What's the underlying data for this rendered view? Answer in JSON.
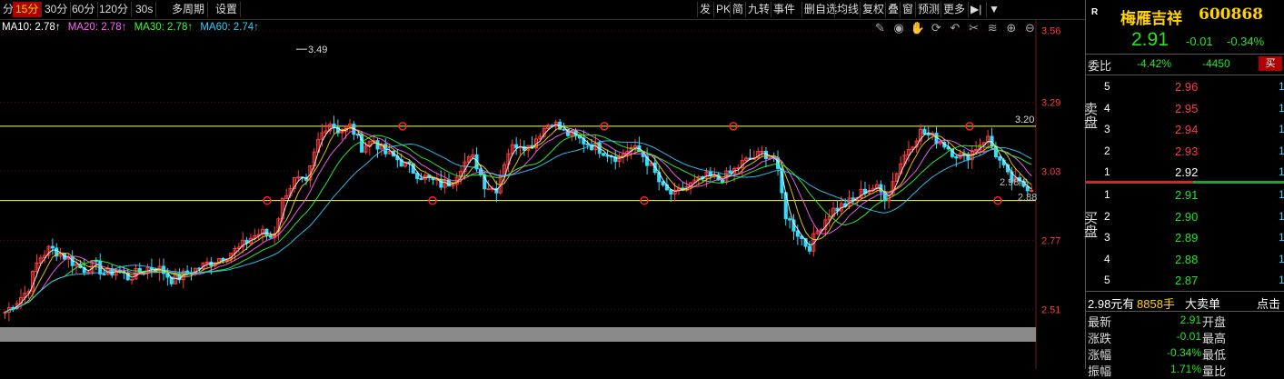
{
  "toolbar": {
    "periods": [
      "分",
      "15分",
      "30分",
      "60分",
      "120分",
      "30s",
      "多周期",
      "设置"
    ],
    "active_period": "15分",
    "tools": [
      "发",
      "PK",
      "简",
      "九转",
      "事件",
      "删自选",
      "均线",
      "复权",
      "叠",
      "窗",
      "预测",
      "更多",
      "▶|",
      "▼"
    ]
  },
  "ma": [
    {
      "label": "MA10: 2.78↑",
      "color": "#ffffff"
    },
    {
      "label": "MA20: 2.78↑",
      "color": "#ff66ff"
    },
    {
      "label": "MA30: 2.78↑",
      "color": "#33ff33"
    },
    {
      "label": "MA60: 2.74↑",
      "color": "#33ccff"
    }
  ],
  "chart_data": {
    "type": "candlestick",
    "y_ticks": [
      3.56,
      3.29,
      3.03,
      2.77,
      2.51
    ],
    "ylim": [
      2.45,
      3.6
    ],
    "resistance_line": 3.2,
    "support_line": 2.92,
    "resistance_label": "3.20",
    "high_label": "3.49",
    "annotations": [
      "2.98-2",
      "2.88"
    ],
    "close_series": [
      2.5,
      2.54,
      2.58,
      2.7,
      2.74,
      2.72,
      2.69,
      2.66,
      2.68,
      2.64,
      2.66,
      2.63,
      2.65,
      2.67,
      2.66,
      2.62,
      2.64,
      2.66,
      2.68,
      2.7,
      2.72,
      2.74,
      2.78,
      2.8,
      2.78,
      2.94,
      3.0,
      2.98,
      3.14,
      3.22,
      3.18,
      3.2,
      3.12,
      3.15,
      3.1,
      3.08,
      3.05,
      3.02,
      3.0,
      2.98,
      2.99,
      3.06,
      3.08,
      2.98,
      2.96,
      3.1,
      3.14,
      3.12,
      3.18,
      3.22,
      3.18,
      3.16,
      3.14,
      3.12,
      3.1,
      3.08,
      3.12,
      3.1,
      3.04,
      2.96,
      2.94,
      2.97,
      2.99,
      3.01,
      3.0,
      3.02,
      3.06,
      3.08,
      3.1,
      3.08,
      2.86,
      2.8,
      2.74,
      2.82,
      2.88,
      2.9,
      2.92,
      2.96,
      2.97,
      2.93,
      3.04,
      3.12,
      3.18,
      3.16,
      3.14,
      3.1,
      3.08,
      3.12,
      3.16,
      3.08,
      3.0,
      2.98,
      2.97
    ],
    "ma_colors": [
      "#ffffff",
      "#ffd200",
      "#ff66ff",
      "#33ff33",
      "#33ccff"
    ]
  },
  "panel": {
    "r_mark": "R",
    "name": "梅雁吉祥",
    "code": "600868",
    "price": "2.91",
    "change": "-0.01",
    "change_pct": "-0.34%",
    "weibi_label": "委比",
    "weibi_pct": "-4.42%",
    "weibi_diff": "-4450",
    "buy_btn": "买",
    "sell_label": "卖盘",
    "buy_label": "买盘",
    "asks": [
      {
        "lvl": "5",
        "price": "2.96",
        "vol": "1"
      },
      {
        "lvl": "4",
        "price": "2.95",
        "vol": "1"
      },
      {
        "lvl": "3",
        "price": "2.94",
        "vol": "1"
      },
      {
        "lvl": "2",
        "price": "2.93",
        "vol": "1"
      },
      {
        "lvl": "1",
        "price": "2.92",
        "vol": "1"
      }
    ],
    "bids": [
      {
        "lvl": "1",
        "price": "2.91",
        "vol": "1"
      },
      {
        "lvl": "2",
        "price": "2.90",
        "vol": "1"
      },
      {
        "lvl": "3",
        "price": "2.89",
        "vol": "1"
      },
      {
        "lvl": "4",
        "price": "2.88",
        "vol": "1"
      },
      {
        "lvl": "5",
        "price": "2.87",
        "vol": "1"
      }
    ],
    "big_order": {
      "price_text": "2.98元有",
      "qty": "8858手",
      "label": "大卖单",
      "action": "点击"
    },
    "stats": [
      {
        "k1": "最新",
        "v1": "2.91",
        "k2": "开盘"
      },
      {
        "k1": "涨跌",
        "v1": "-0.01",
        "k2": "最高"
      },
      {
        "k1": "涨幅",
        "v1": "-0.34%",
        "k2": "最低"
      },
      {
        "k1": "振幅",
        "v1": "1.71%",
        "k2": "量比"
      }
    ]
  }
}
